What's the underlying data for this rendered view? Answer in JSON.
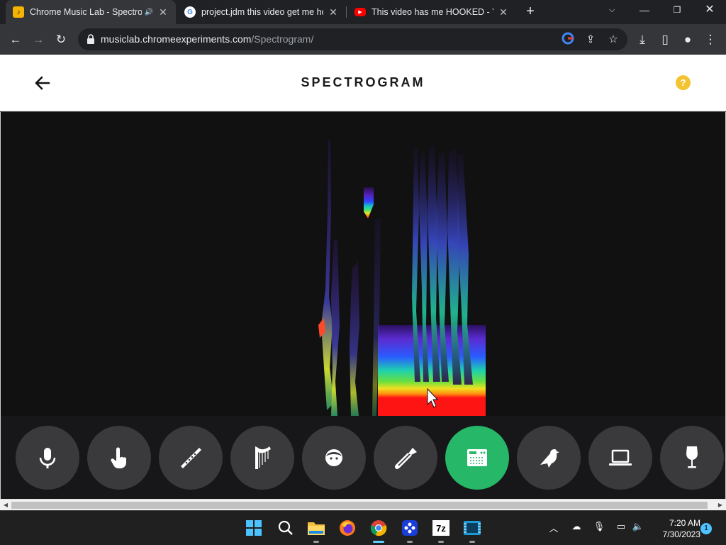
{
  "browser": {
    "tabs": [
      {
        "title": "Chrome Music Lab - Spectro",
        "icon": "music-lab-icon",
        "audio": true,
        "active": true
      },
      {
        "title": "project.jdm this video get me ho",
        "icon": "google-icon",
        "active": false
      },
      {
        "title": "This video has me HOOKED - You",
        "icon": "youtube-icon",
        "active": false
      }
    ],
    "url_domain": "musiclab.chromeexperiments.com",
    "url_path": "/Spectrogram/"
  },
  "app": {
    "title": "SPECTROGRAM",
    "help_label": "?",
    "accent_color": "#26b768",
    "help_color": "#f4c331",
    "instruments": [
      {
        "name": "microphone",
        "active": false
      },
      {
        "name": "hand",
        "active": false
      },
      {
        "name": "flute",
        "active": false
      },
      {
        "name": "harp",
        "active": false
      },
      {
        "name": "voice",
        "active": false
      },
      {
        "name": "trombone",
        "active": false
      },
      {
        "name": "synth",
        "active": true
      },
      {
        "name": "bird",
        "active": false
      },
      {
        "name": "laptop",
        "active": false
      },
      {
        "name": "wine-glass",
        "active": false
      }
    ]
  },
  "taskbar": {
    "apps": [
      "windows-start",
      "search",
      "file-explorer",
      "firefox",
      "chrome",
      "app-blue",
      "7zip",
      "video-editor"
    ],
    "time": "7:20 AM",
    "date": "7/30/2023",
    "notification_count": "1"
  }
}
